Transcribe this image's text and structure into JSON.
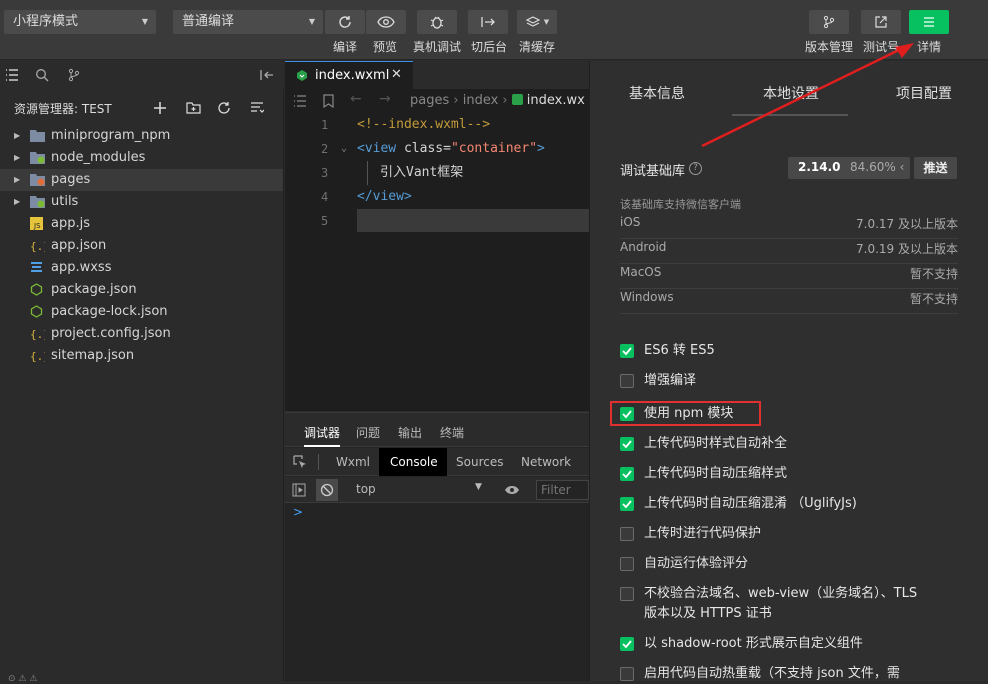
{
  "toolbar": {
    "mode_select": "小程序模式",
    "compile_select": "普通编译",
    "labels": {
      "compile": "编译",
      "preview": "预览",
      "device_debug": "真机调试",
      "background": "切后台",
      "clear_cache": "清缓存"
    },
    "right_labels": {
      "version": "版本管理",
      "test": "测试号",
      "details": "详情"
    }
  },
  "explorer": {
    "title": "资源管理器: TEST",
    "items": [
      {
        "name": "miniprogram_npm",
        "type": "folder",
        "icon": "folder-icon"
      },
      {
        "name": "node_modules",
        "type": "folder",
        "icon": "folder-node-icon"
      },
      {
        "name": "pages",
        "type": "folder",
        "icon": "folder-pages-icon"
      },
      {
        "name": "utils",
        "type": "folder",
        "icon": "folder-utils-icon"
      },
      {
        "name": "app.js",
        "type": "file",
        "icon": "js-icon"
      },
      {
        "name": "app.json",
        "type": "file",
        "icon": "json-icon"
      },
      {
        "name": "app.wxss",
        "type": "file",
        "icon": "css-icon"
      },
      {
        "name": "package.json",
        "type": "file",
        "icon": "npm-icon"
      },
      {
        "name": "package-lock.json",
        "type": "file",
        "icon": "npm-icon"
      },
      {
        "name": "project.config.json",
        "type": "file",
        "icon": "json-icon"
      },
      {
        "name": "sitemap.json",
        "type": "file",
        "icon": "json-icon"
      }
    ]
  },
  "editor": {
    "tab": "index.wxml",
    "breadcrumb": [
      "pages",
      "index",
      "index.wx"
    ],
    "lines": [
      {
        "n": "1",
        "parts": [
          {
            "t": "<!--index.wxml-->",
            "c": "#c29b3a"
          }
        ]
      },
      {
        "n": "2",
        "parts": [
          {
            "t": "<view ",
            "c": "#569cd6"
          },
          {
            "t": "class=",
            "c": "#d4d4d4"
          },
          {
            "t": "\"container\"",
            "c": "#f48771"
          },
          {
            "t": ">",
            "c": "#569cd6"
          }
        ]
      },
      {
        "n": "3",
        "parts": [
          {
            "t": "引入Vant框架",
            "c": "#d4d4d4"
          }
        ]
      },
      {
        "n": "4",
        "parts": [
          {
            "t": "</view>",
            "c": "#569cd6"
          }
        ]
      },
      {
        "n": "5",
        "parts": []
      }
    ]
  },
  "devtools": {
    "tabs": [
      "调试器",
      "问题",
      "输出",
      "终端"
    ],
    "subtabs": [
      "Wxml",
      "Console",
      "Sources",
      "Network"
    ],
    "context": "top",
    "filter_placeholder": "Filter",
    "prompt": ">"
  },
  "panel": {
    "tabs": [
      "基本信息",
      "本地设置",
      "项目配置"
    ],
    "base_lib_label": "调试基础库",
    "base_lib_version": "2.14.0",
    "base_lib_percent": "84.60% ‹",
    "push_button": "推送",
    "support_note": "该基础库支持微信客户端",
    "platforms": [
      {
        "name": "iOS",
        "value": "7.0.17 及以上版本"
      },
      {
        "name": "Android",
        "value": "7.0.19 及以上版本"
      },
      {
        "name": "MacOS",
        "value": "暂不支持"
      },
      {
        "name": "Windows",
        "value": "暂不支持"
      }
    ],
    "options": [
      {
        "label": "ES6 转 ES5",
        "checked": true
      },
      {
        "label": "增强编译",
        "checked": false
      },
      {
        "label": "使用 npm 模块",
        "checked": true
      },
      {
        "label": "上传代码时样式自动补全",
        "checked": true
      },
      {
        "label": "上传代码时自动压缩样式",
        "checked": true
      },
      {
        "label": "上传代码时自动压缩混淆 （UglifyJs)",
        "checked": true
      },
      {
        "label": "上传时进行代码保护",
        "checked": false
      },
      {
        "label": "自动运行体验评分",
        "checked": false
      },
      {
        "label": "不校验合法域名、web-view（业务域名）、TLS",
        "label2": "版本以及 HTTPS 证书",
        "checked": false
      },
      {
        "label": "以 shadow-root 形式展示自定义组件",
        "checked": true
      },
      {
        "label": "启用代码自动热重载（不支持 json 文件，需",
        "checked": false
      }
    ]
  },
  "colors": {
    "accent": "#07c160",
    "highlight_box": "#e03030",
    "arrow": "#e01e1e"
  }
}
